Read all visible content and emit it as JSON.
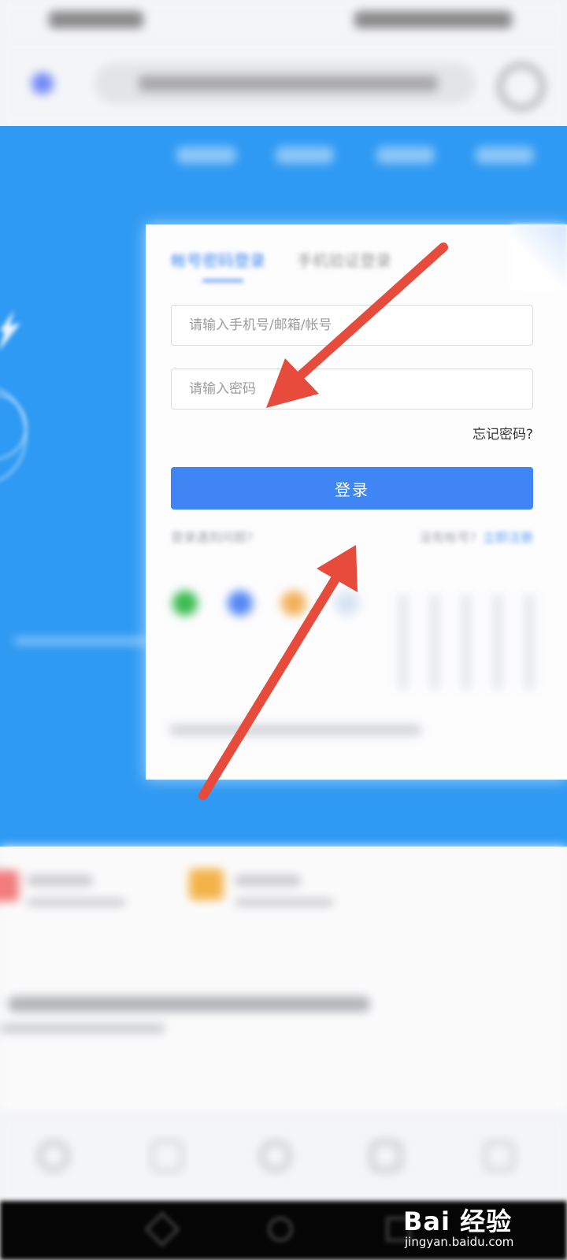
{
  "login": {
    "tabs": {
      "password": "帐号密码登录",
      "sms": "手机验证登录"
    },
    "account_placeholder": "请输入手机号/邮箱/帐号",
    "password_placeholder": "请输入密码",
    "forgot": "忘记密码?",
    "submit": "登录",
    "problem": "登录遇到问题?",
    "no_account": "没有帐号?",
    "signup": "立即注册"
  },
  "watermark": {
    "brand": "Bai 经验",
    "site": "jingyan.baidu.com"
  },
  "colors": {
    "hero_blue": "#2f9af3",
    "primary_button": "#3f86f4",
    "active_tab": "#3c86ef",
    "annotation_arrow": "#e64b3b"
  },
  "icons": [
    "wechat-icon",
    "qq-icon",
    "weibo-icon",
    "back-icon",
    "home-icon",
    "tabs-icon",
    "menu-icon"
  ]
}
